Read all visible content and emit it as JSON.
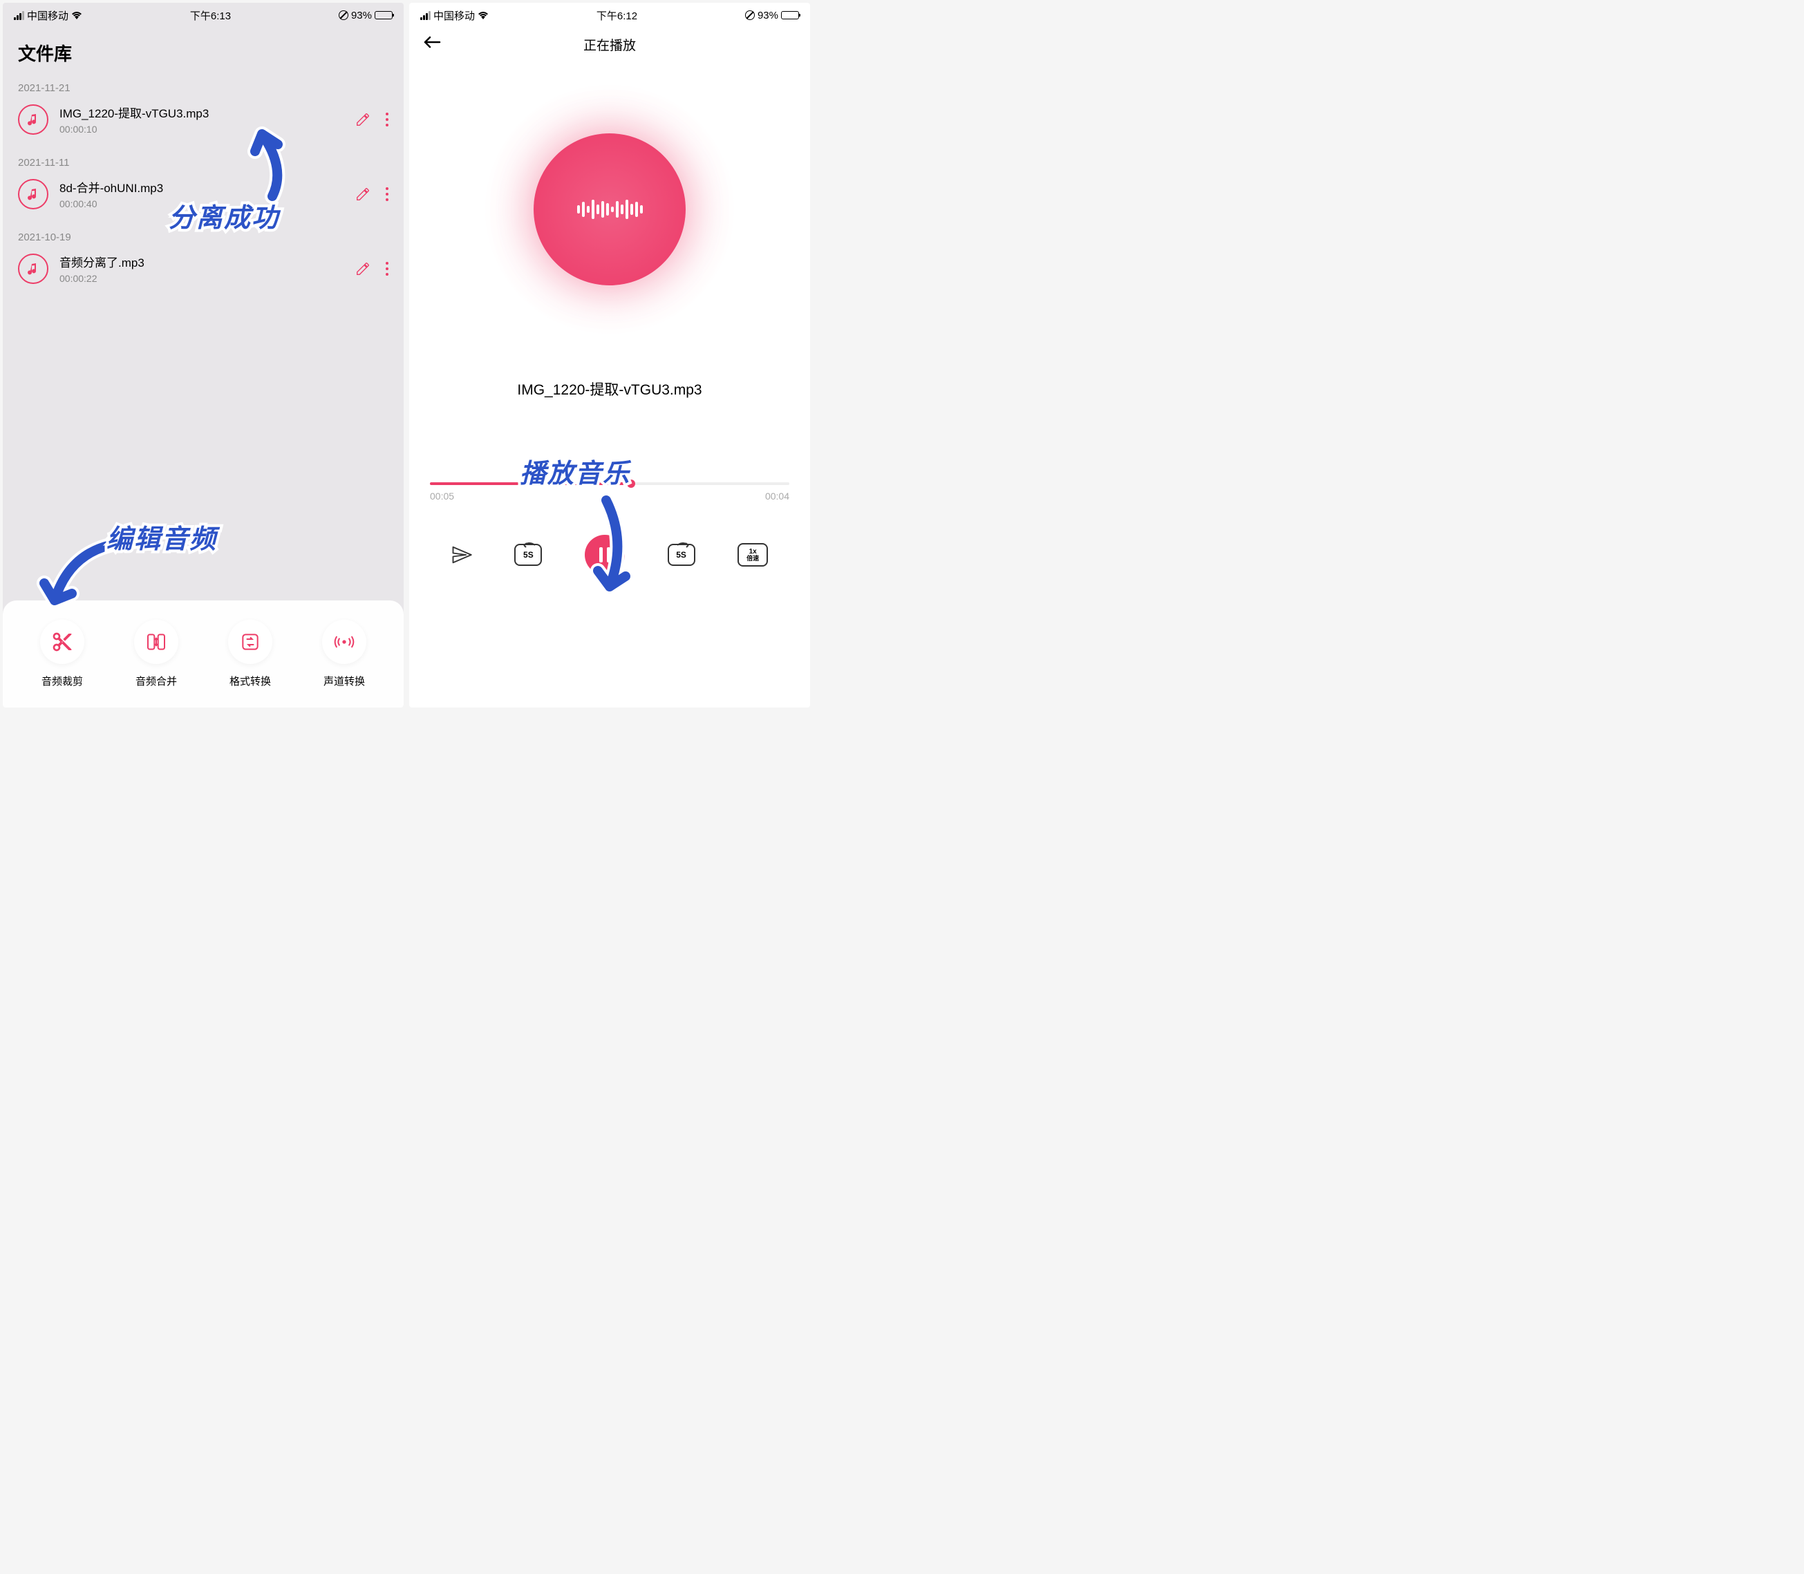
{
  "left": {
    "status": {
      "carrier": "中国移动",
      "time": "下午6:13",
      "battery": "93%"
    },
    "page_title": "文件库",
    "files": [
      {
        "date": "2021-11-21",
        "name": "IMG_1220-提取-vTGU3.mp3",
        "duration": "00:00:10"
      },
      {
        "date": "2021-11-11",
        "name": "8d-合并-ohUNI.mp3",
        "duration": "00:00:40"
      },
      {
        "date": "2021-10-19",
        "name": "音频分离了.mp3",
        "duration": "00:00:22"
      }
    ],
    "tools": {
      "trim": "音频裁剪",
      "merge": "音频合并",
      "format": "格式转换",
      "channel": "声道转换"
    }
  },
  "right": {
    "status": {
      "carrier": "中国移动",
      "time": "下午6:12",
      "battery": "93%"
    },
    "nav_title": "正在播放",
    "track_name": "IMG_1220-提取-vTGU3.mp3",
    "progress": {
      "current": "00:05",
      "remaining": "00:04"
    },
    "controls": {
      "skip_back": "5S",
      "skip_fwd": "5S",
      "speed_rate": "1x",
      "speed_label": "倍速"
    }
  },
  "annotations": {
    "separation_success": "分离成功",
    "edit_audio": "编辑音频",
    "play_music": "播放音乐"
  }
}
